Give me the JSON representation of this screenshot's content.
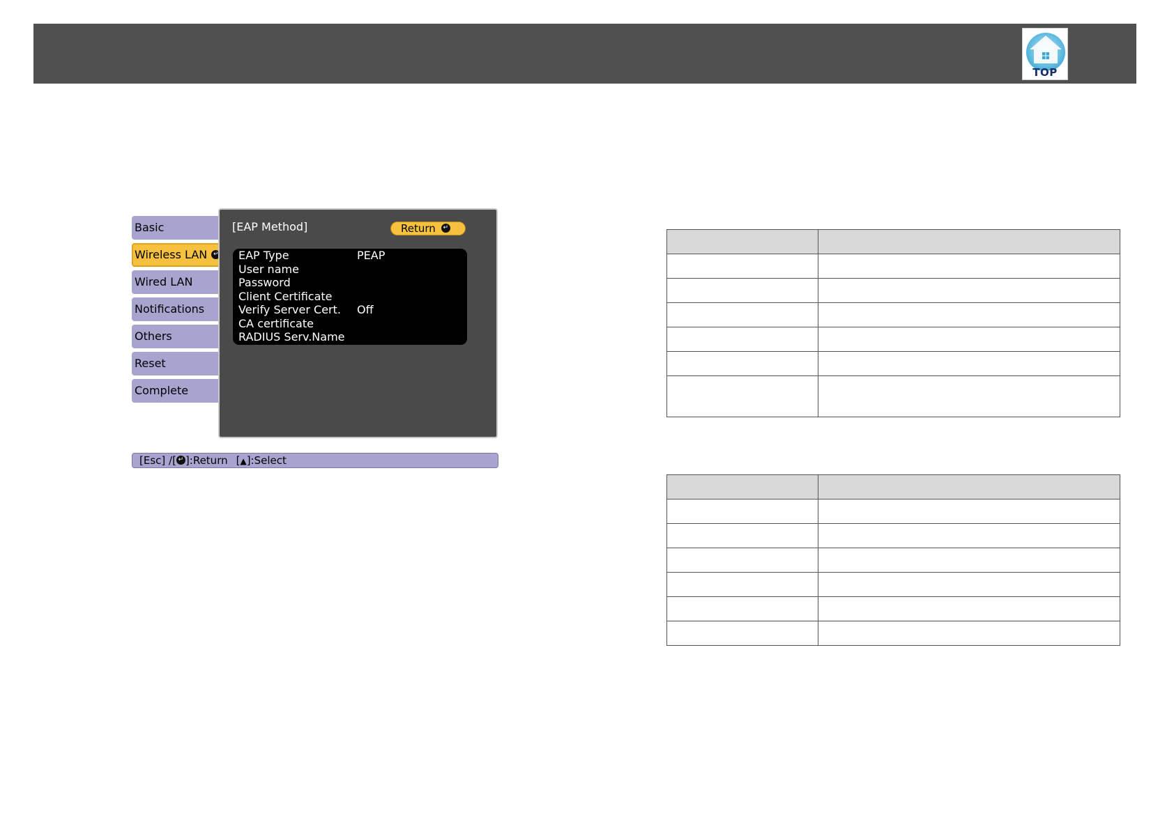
{
  "header": {
    "top_button_label": "TOP",
    "background_color": "#505050"
  },
  "projector_menu": {
    "tabs": [
      {
        "label": "Basic",
        "active": false
      },
      {
        "label": "Wireless LAN",
        "active": true
      },
      {
        "label": "Wired LAN",
        "active": false
      },
      {
        "label": "Notifications",
        "active": false
      },
      {
        "label": "Others",
        "active": false
      },
      {
        "label": "Reset",
        "active": false
      },
      {
        "label": "Complete",
        "active": false
      }
    ],
    "panel_title": "[EAP Method]",
    "return_label": "Return",
    "settings": [
      {
        "label": "EAP Type",
        "value": "PEAP"
      },
      {
        "label": "User name",
        "value": ""
      },
      {
        "label": "Password",
        "value": ""
      },
      {
        "label": "Client Certificate",
        "value": ""
      },
      {
        "label": "Verify Server Cert.",
        "value": "Off"
      },
      {
        "label": "CA certificate",
        "value": ""
      },
      {
        "label": "RADIUS Serv.Name",
        "value": ""
      }
    ],
    "status_bar": {
      "esc": "[Esc] /[",
      "return": "]:Return",
      "select_open": "[",
      "select": "]:Select"
    },
    "colors": {
      "tab_bg": "#a7a4cf",
      "active_tab_bg": "#f5c13f",
      "panel_bg": "#4a4a4a"
    }
  }
}
